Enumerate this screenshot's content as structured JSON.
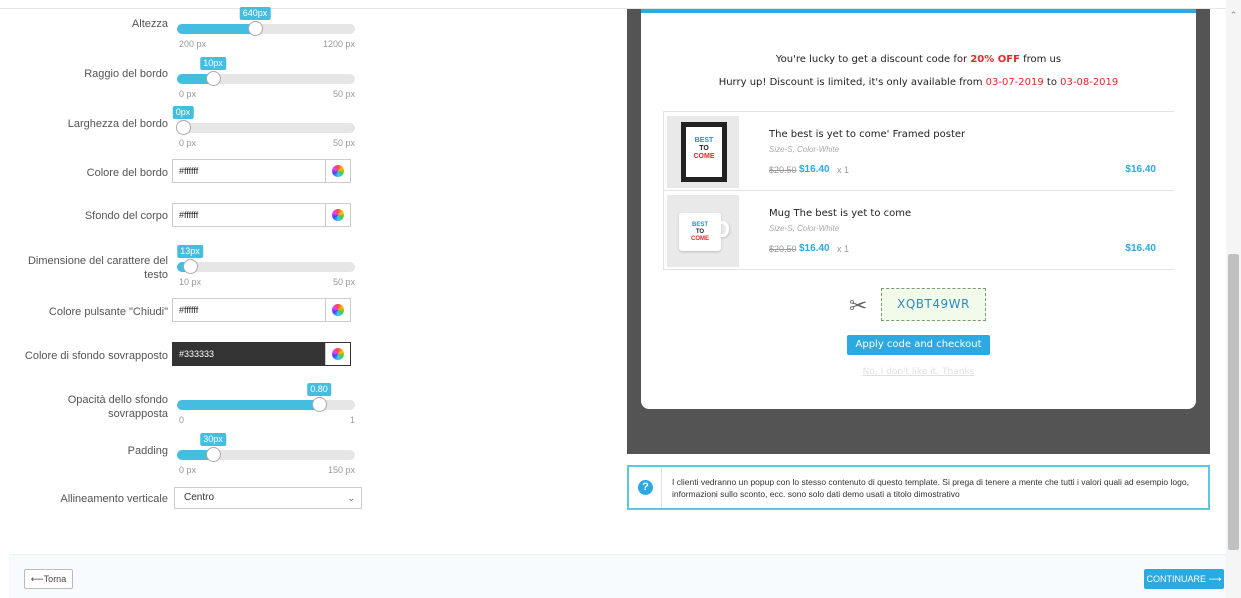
{
  "form": {
    "height": {
      "label": "Altezza",
      "value": "640px",
      "min": "200 px",
      "max": "1200 px",
      "fraction": 0.44
    },
    "border_radius": {
      "label": "Raggio del bordo",
      "value": "10px",
      "min": "0 px",
      "max": "50 px",
      "fraction": 0.2
    },
    "border_width": {
      "label": "Larghezza del bordo",
      "value": "0px",
      "min": "0 px",
      "max": "50 px",
      "fraction": 0.0
    },
    "border_color": {
      "label": "Colore del bordo",
      "value": "#ffffff"
    },
    "body_bg": {
      "label": "Sfondo del corpo",
      "value": "#ffffff"
    },
    "font_size": {
      "label_line1": "Dimensione del carattere del",
      "label_line2": "testo",
      "value": "13px",
      "min": "10 px",
      "max": "50 px",
      "fraction": 0.075
    },
    "close_color": {
      "label": "Colore pulsante \"Chiudi\"",
      "value": "#ffffff"
    },
    "overlay_bg": {
      "label": "Colore di sfondo sovrapposto",
      "value": "#333333"
    },
    "overlay_opacity": {
      "label_line1": "Opacità dello sfondo",
      "label_line2": "sovrapposta",
      "value": "0.80",
      "min": "0",
      "max": "1",
      "fraction": 0.8
    },
    "padding": {
      "label": "Padding",
      "value": "30px",
      "min": "0 px",
      "max": "150 px",
      "fraction": 0.2
    },
    "vertical_align": {
      "label": "Allineamento verticale",
      "value": "Centro"
    }
  },
  "preview": {
    "line1_pre": "You're lucky to get a discount code for ",
    "line1_bold": "20% OFF",
    "line1_post": " from us",
    "line2_pre": "Hurry up! Discount is limited, it's only available from ",
    "date_from": "03-07-2019",
    "line2_mid": " to ",
    "date_to": "03-08-2019",
    "products": [
      {
        "name": "The best is yet to come' Framed poster",
        "attrs": "Size-S, Color-White",
        "old_price": "$20.50",
        "new_price": "$16.40",
        "qty": "x 1",
        "total": "$16.40"
      },
      {
        "name": "Mug The best is yet to come",
        "attrs": "Size-S, Color-White",
        "old_price": "$20.50",
        "new_price": "$16.40",
        "qty": "x 1",
        "total": "$16.40"
      }
    ],
    "code": "XQBT49WR",
    "apply_button": "Apply code and checkout",
    "no_thanks": "No, I don't like it. Thanks"
  },
  "info": {
    "text": "I clienti vedranno un popup con lo stesso contenuto di questo template. Si prega di tenere a mente che tutti i valori quali ad esempio logo, informazioni sullo sconto, ecc. sono solo dati demo usati a titolo dimostrativo"
  },
  "footer": {
    "back_label": "⟵Torna",
    "next_label": "CONTINUARE ⟶"
  },
  "colors": {
    "accent": "#2ba9e0",
    "slider": "#45bde0",
    "discount_red": "#e02a2a",
    "overlay": "#545454"
  }
}
